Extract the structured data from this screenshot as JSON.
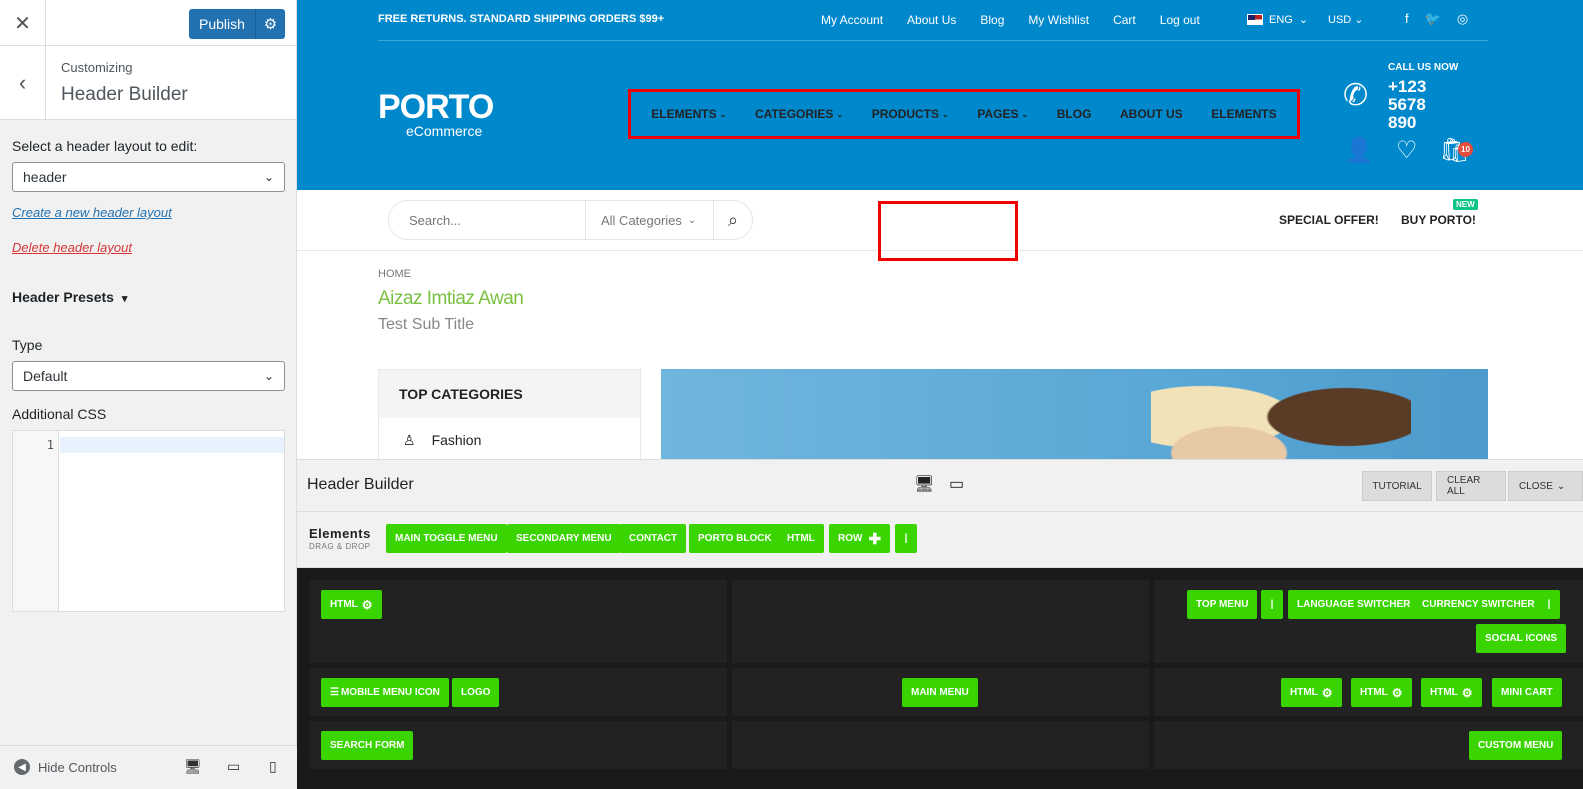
{
  "sidebar": {
    "publish_label": "Publish",
    "customizing": "Customizing",
    "section_title": "Header Builder",
    "select_layout_label": "Select a header layout to edit:",
    "layout_value": "header",
    "create_link": "Create a new header layout",
    "delete_link": "Delete header layout",
    "presets_label": "Header Presets",
    "type_label": "Type",
    "type_value": "Default",
    "css_label": "Additional CSS",
    "css_line_number": "1",
    "hide_controls": "Hide Controls",
    "colors": {
      "publish": "#2271b1",
      "create_link": "#2271b1",
      "delete_link": "#d63638"
    }
  },
  "site": {
    "topbar_text": "FREE RETURNS. STANDARD SHIPPING ORDERS $99+",
    "top_links": [
      "My Account",
      "About Us",
      "Blog",
      "My Wishlist",
      "Cart",
      "Log out"
    ],
    "language": "ENG",
    "currency": "USD",
    "logo_main": "PORTO",
    "logo_sub": "eCommerce",
    "nav_items": [
      {
        "label": "ELEMENTS",
        "dropdown": true
      },
      {
        "label": "CATEGORIES",
        "dropdown": true
      },
      {
        "label": "PRODUCTS",
        "dropdown": true
      },
      {
        "label": "PAGES",
        "dropdown": true
      },
      {
        "label": "BLOG",
        "dropdown": false
      },
      {
        "label": "ABOUT US",
        "dropdown": false
      },
      {
        "label": "ELEMENTS",
        "dropdown": false
      }
    ],
    "call_us": "CALL US NOW",
    "phone": "+123 5678 890",
    "cart_count": "10",
    "search_placeholder": "Search...",
    "category_select": "All Categories",
    "special_offer": "SPECIAL OFFER!",
    "buy_porto": "BUY PORTO!",
    "new_badge": "NEW",
    "breadcrumb": "HOME",
    "page_title": "Aizaz Imtiaz Awan",
    "page_subtitle": "Test Sub Title",
    "top_categories_title": "TOP CATEGORIES",
    "top_category_item": "Fashion",
    "colors": {
      "header_bg": "#0088cc",
      "title_green": "#7ac142",
      "badge_red": "#e74c3c",
      "new_green": "#0cc485"
    }
  },
  "builder": {
    "title": "Header Builder",
    "tutorial": "TUTORIAL",
    "clear_all": "CLEAR ALL",
    "close": "CLOSE",
    "elements_label": "Elements",
    "elements_sub": "DRAG & DROP",
    "palette": [
      "MAIN TOGGLE MENU",
      "SECONDARY MENU",
      "CONTACT",
      "PORTO BLOCK",
      "HTML",
      "ROW",
      "|"
    ],
    "row1_left": [
      "HTML"
    ],
    "row1_right": [
      "TOP MENU",
      "|",
      "LANGUAGE SWITCHER",
      "CURRENCY SWITCHER",
      "|",
      "SOCIAL ICONS"
    ],
    "row2_left": [
      "MOBILE MENU ICON",
      "LOGO"
    ],
    "row2_center": [
      "MAIN MENU"
    ],
    "row2_right": [
      "HTML",
      "HTML",
      "HTML",
      "MINI CART"
    ],
    "row3_left": [
      "SEARCH FORM"
    ],
    "row3_right": [
      "CUSTOM MENU"
    ],
    "colors": {
      "chip": "#3ad400",
      "grid_bg": "#1a1a1a",
      "highlight": "#ee0000"
    }
  }
}
